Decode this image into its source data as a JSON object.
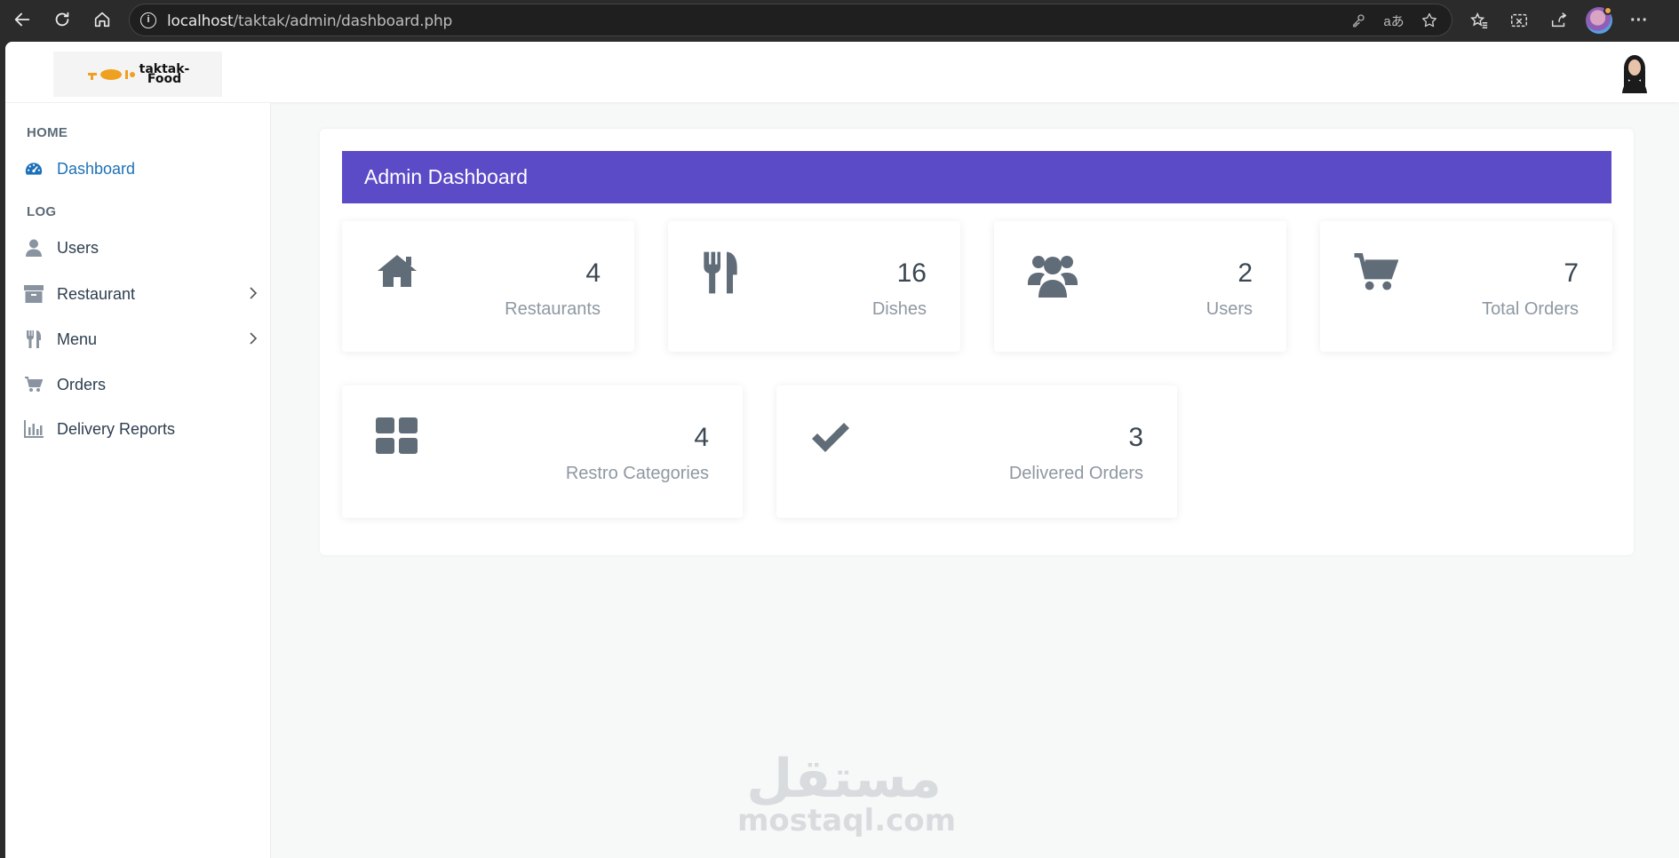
{
  "browser": {
    "url_host": "localhost",
    "url_path": "/taktak/admin/dashboard.php"
  },
  "brand": {
    "logo_text_1": "taktak-",
    "logo_text_2": "Food",
    "accent": "#5c4bc7",
    "link": "#1d71b8"
  },
  "sidebar": {
    "sections": [
      {
        "label": "HOME"
      },
      {
        "label": "LOG"
      }
    ],
    "items": [
      {
        "label": "Dashboard",
        "icon": "dashboard-icon",
        "active": true
      },
      {
        "label": "Users",
        "icon": "user-icon"
      },
      {
        "label": "Restaurant",
        "icon": "archive-icon",
        "has_submenu": true
      },
      {
        "label": "Menu",
        "icon": "utensils-icon",
        "has_submenu": true
      },
      {
        "label": "Orders",
        "icon": "cart-icon"
      },
      {
        "label": "Delivery Reports",
        "icon": "bar-chart-icon"
      }
    ]
  },
  "main": {
    "title": "Admin Dashboard",
    "stats": [
      {
        "value": "4",
        "label": "Restaurants",
        "icon": "home-icon"
      },
      {
        "value": "16",
        "label": "Dishes",
        "icon": "utensils-icon"
      },
      {
        "value": "2",
        "label": "Users",
        "icon": "users-icon"
      },
      {
        "value": "7",
        "label": "Total Orders",
        "icon": "cart-icon"
      },
      {
        "value": "4",
        "label": "Restro Categories",
        "icon": "grid-icon"
      },
      {
        "value": "3",
        "label": "Delivered Orders",
        "icon": "check-icon"
      }
    ]
  },
  "watermark": {
    "arabic": "مستقل",
    "latin": "mostaql.com"
  }
}
